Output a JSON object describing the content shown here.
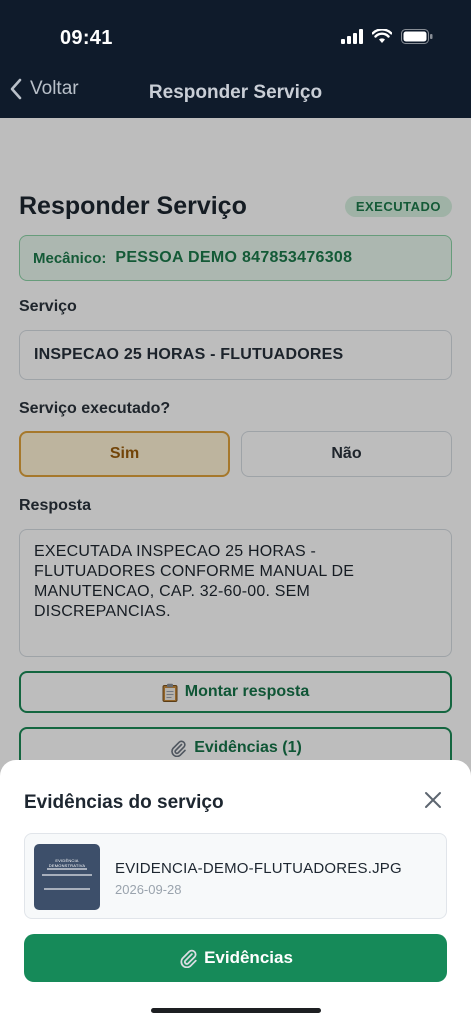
{
  "status_bar": {
    "time": "09:41"
  },
  "nav": {
    "back_label": "Voltar",
    "title": "Responder Serviço"
  },
  "page": {
    "title": "Responder Serviço",
    "status_badge": "EXECUTADO",
    "mechanic_label": "Mecânico:",
    "mechanic_value": "PESSOA DEMO 847853476308",
    "service_label": "Serviço",
    "service_value": "INSPECAO 25 HORAS - FLUTUADORES",
    "executed_label": "Serviço executado?",
    "yes_label": "Sim",
    "no_label": "Não",
    "selected": "Sim",
    "response_label": "Resposta",
    "response_value": "EXECUTADA INSPECAO 25 HORAS - FLUTUADORES CONFORME MANUAL DE MANUTENCAO, CAP. 32-60-00. SEM DISCREPANCIAS.",
    "build_response_button": "Montar resposta",
    "evidences_button": "Evidências (1)"
  },
  "sheet": {
    "title": "Evidências do serviço",
    "evidence": {
      "file_name": "EVIDENCIA-DEMO-FLUTUADORES.JPG",
      "date": "2026-09-28",
      "thumb_title": "EVIDÊNCIA DEMONSTRATIVA"
    },
    "primary_button": "Evidências"
  },
  "icons": {
    "back": "chevron-left-icon",
    "signal": "cellular-signal-icon",
    "wifi": "wifi-icon",
    "battery": "battery-icon",
    "clipboard": "clipboard-icon",
    "paperclip": "paperclip-icon",
    "close": "close-icon"
  },
  "colors": {
    "navy": "#0f1b2b",
    "brand_green": "#168a59",
    "badge_bg": "#d7f1e0",
    "selected_amber": "#e0a33a"
  }
}
